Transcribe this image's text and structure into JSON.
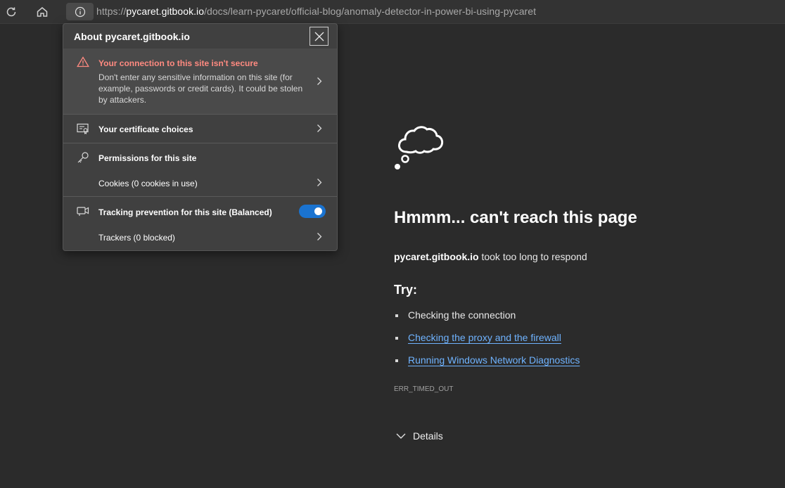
{
  "toolbar": {
    "refresh_icon": "refresh-icon",
    "home_icon": "home-icon",
    "site_info_icon": "info-icon",
    "url_prefix": "https://",
    "url_host": "pycaret.gitbook.io",
    "url_path": "/docs/learn-pycaret/official-blog/anomaly-detector-in-power-bi-using-pycaret"
  },
  "popup": {
    "title": "About pycaret.gitbook.io",
    "warning_title": "Your connection to this site isn't secure",
    "warning_body": "Don't enter any sensitive information on this site (for example, passwords or credit cards). It could be stolen by attackers.",
    "certificate_label": "Your certificate choices",
    "permissions_label": "Permissions for this site",
    "cookies_label": "Cookies (0 cookies in use)",
    "tracking_label": "Tracking prevention for this site (Balanced)",
    "tracking_enabled": true,
    "trackers_label": "Trackers (0 blocked)"
  },
  "error_page": {
    "title": "Hmmm... can't reach this page",
    "host": "pycaret.gitbook.io",
    "message": " took too long to respond",
    "try_heading": "Try:",
    "suggestions": [
      "Checking the connection",
      "Checking the proxy and the firewall",
      "Running Windows Network Diagnostics"
    ],
    "error_code": "ERR_TIMED_OUT",
    "details_label": "Details"
  },
  "colors": {
    "background": "#2b2b2b",
    "link": "#6fb3ff",
    "warning": "#ff8a80",
    "toggle": "#1a73d0"
  }
}
